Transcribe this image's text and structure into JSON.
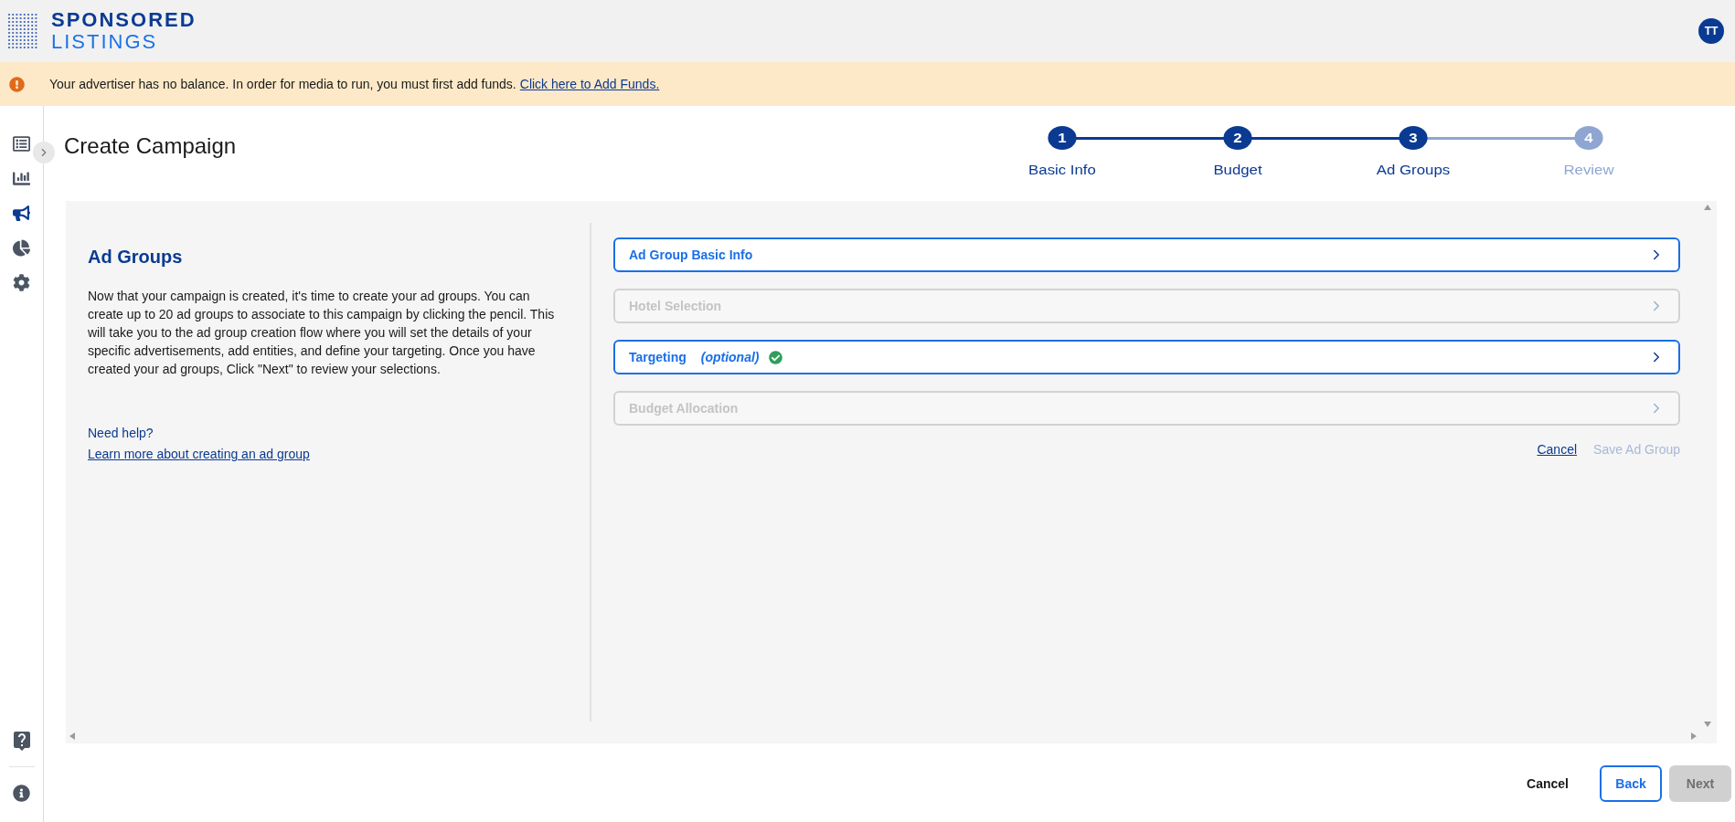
{
  "header": {
    "logo_top": "SPONSORED",
    "logo_bottom": "LISTINGS",
    "avatar": "TT"
  },
  "banner": {
    "message": "Your advertiser has no balance. In order for media to run, you must first add funds.",
    "link": "Click here to Add Funds."
  },
  "sidebar": {
    "items": [
      {
        "kind": "list",
        "selected": false
      },
      {
        "kind": "bars",
        "selected": false
      },
      {
        "kind": "megaphone",
        "selected": true
      },
      {
        "kind": "pie",
        "selected": false
      },
      {
        "kind": "gear",
        "selected": false
      }
    ],
    "bottom_items": [
      {
        "kind": "help"
      },
      {
        "kind": "info"
      }
    ]
  },
  "page": {
    "title": "Create Campaign"
  },
  "stepper": [
    {
      "number": "1",
      "label": "Basic Info",
      "active": true
    },
    {
      "number": "2",
      "label": "Budget",
      "active": true
    },
    {
      "number": "3",
      "label": "Ad Groups",
      "active": true
    },
    {
      "number": "4",
      "label": "Review",
      "active": false
    }
  ],
  "intro": {
    "heading": "Ad Groups",
    "body": "Now that your campaign is created, it's time to create your ad groups. You can create up to 20 ad groups to associate to this campaign by clicking the pencil. This will take you to the ad group creation flow where you will set the details of your specific advertisements, add entities, and define your targeting. Once you have created your ad groups, Click \"Next\" to review your selections.",
    "help_label": "Need help?",
    "help_link": "Learn more about creating an ad group"
  },
  "sections": [
    {
      "title": "Ad Group Basic Info",
      "disabled": false,
      "complete": false
    },
    {
      "title": "Hotel Selection",
      "disabled": true,
      "complete": false
    },
    {
      "title": "Targeting",
      "note": "(optional)",
      "disabled": false,
      "complete": true
    },
    {
      "title": "Budget Allocation",
      "disabled": true,
      "complete": false
    }
  ],
  "section_actions": {
    "cancel": "Cancel",
    "save": {
      "label": "Save Ad Group",
      "disabled": true
    }
  },
  "footer": {
    "cancel": "Cancel",
    "back": "Back",
    "next": {
      "label": "Next",
      "disabled": true
    }
  }
}
